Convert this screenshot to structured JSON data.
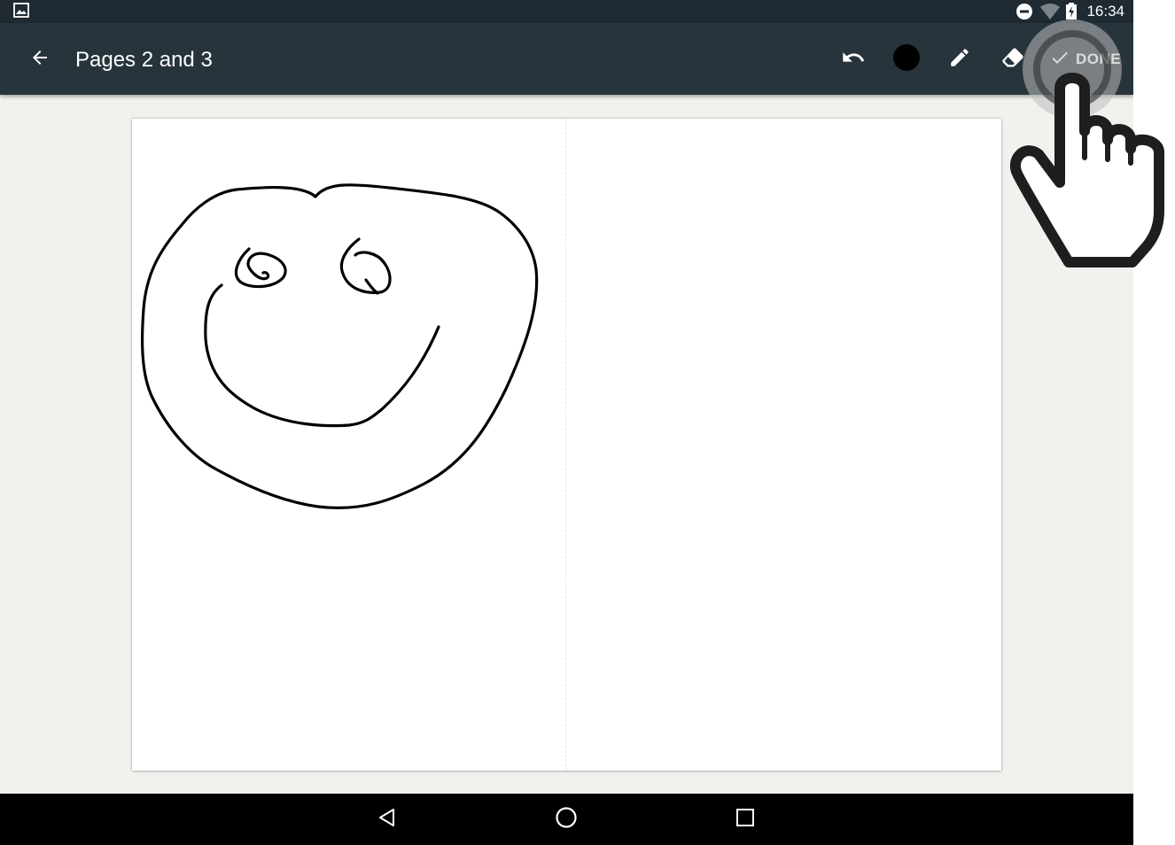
{
  "status_bar": {
    "time": "16:34",
    "icons": [
      "image-notification-icon",
      "do-not-disturb-icon",
      "wifi-icon",
      "battery-charging-icon"
    ]
  },
  "app_bar": {
    "back_icon": "arrow-back-icon",
    "title": "Pages 2 and 3",
    "actions": {
      "undo_icon": "undo-icon",
      "color_icon": "color-swatch-icon",
      "color_value": "#000000",
      "pen_icon": "pencil-icon",
      "eraser_icon": "eraser-icon",
      "done_label": "DONE",
      "done_icon": "check-icon"
    }
  },
  "canvas": {
    "background": "#ffffff",
    "drawing": "hand-drawn smiley face on left page"
  },
  "nav_bar": {
    "back_icon": "nav-back-icon",
    "home_icon": "nav-home-icon",
    "recents_icon": "nav-recents-icon"
  },
  "colors": {
    "status_bar": "#1f2a32",
    "app_bar": "#27343c",
    "page_background": "#f2f1ee",
    "nav_bar": "#000000"
  }
}
